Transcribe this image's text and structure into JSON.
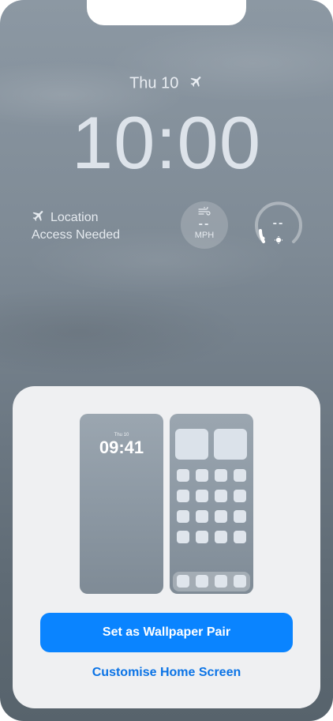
{
  "lockscreen": {
    "date": "Thu 10",
    "time": "10:00",
    "location_line1": "Location",
    "location_line2": "Access Needed",
    "wind_value": "--",
    "wind_unit": "MPH",
    "gauge_value": "--"
  },
  "sheet": {
    "lock_preview": {
      "date": "Thu 10",
      "time": "09:41"
    },
    "primary_button": "Set as Wallpaper Pair",
    "secondary_link": "Customise Home Screen"
  },
  "colors": {
    "accent": "#0a84ff",
    "link": "#0a73e6",
    "sheet_bg": "#eff0f2"
  }
}
